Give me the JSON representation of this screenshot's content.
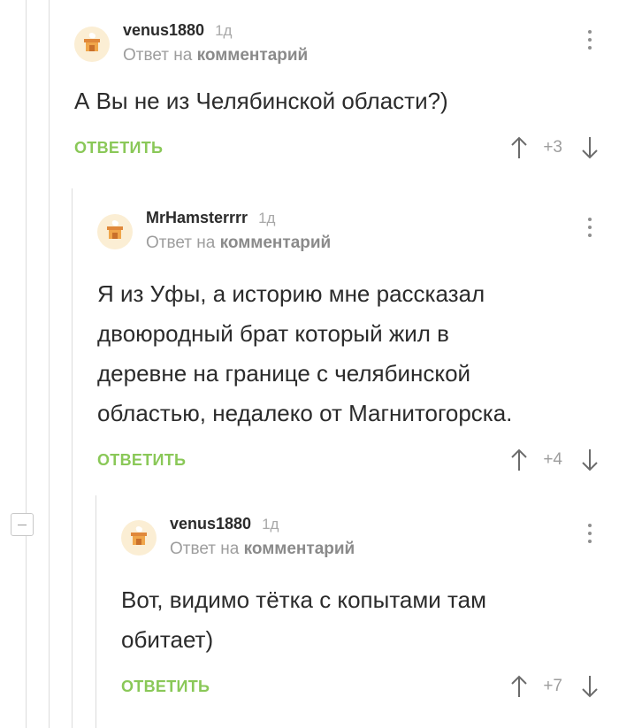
{
  "comments": [
    {
      "username": "venus1880",
      "time": "1д",
      "reply_prefix": "Ответ на",
      "reply_link": "комментарий",
      "text": "А Вы не из Челябинской области?)",
      "reply_label": "ОТВЕТИТЬ",
      "rating": "+3"
    },
    {
      "username": "MrHamsterrrr",
      "time": "1д",
      "reply_prefix": "Ответ на",
      "reply_link": "комментарий",
      "text": "Я из Уфы, а историю мне рассказал двоюродный брат который жил в деревне на границе с челябинской областью, недалеко от Магнитогорска.",
      "reply_label": "ОТВЕТИТЬ",
      "rating": "+4"
    },
    {
      "username": "venus1880",
      "time": "1д",
      "reply_prefix": "Ответ на",
      "reply_link": "комментарий",
      "text": "Вот, видимо тётка с копытами там обитает)",
      "reply_label": "ОТВЕТИТЬ",
      "rating": "+7"
    }
  ],
  "icons": {
    "avatar": "default-avatar-icon",
    "menu": "more-vertical-icon",
    "upvote": "arrow-up-icon",
    "downvote": "arrow-down-icon",
    "collapse": "minus-icon"
  },
  "colors": {
    "accent": "#8ac858",
    "text": "#2b2b2b",
    "muted": "#9d9d9d",
    "thread_line": "#dcdcdc"
  }
}
